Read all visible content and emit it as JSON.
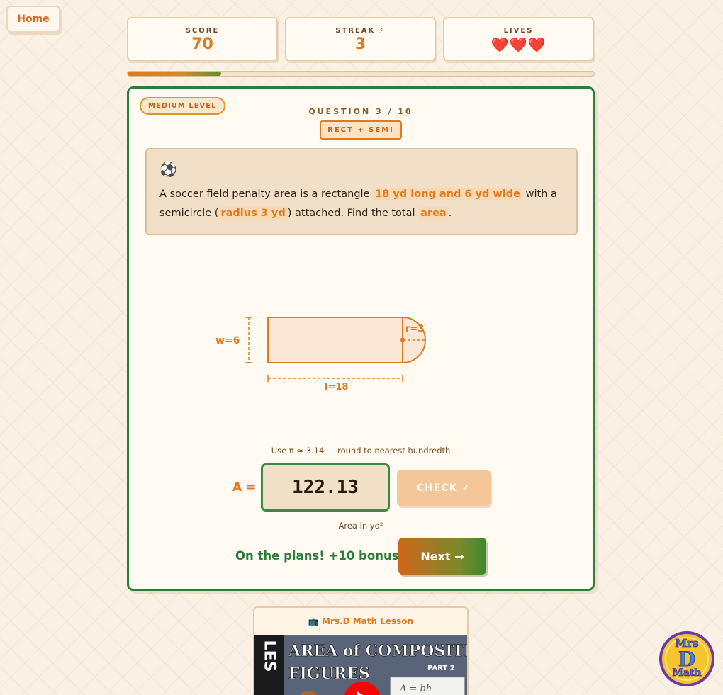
{
  "nav": {
    "home_label": "Home"
  },
  "stats": {
    "score_label": "SCORE",
    "score_value": "70",
    "streak_label": "STREAK ⚡",
    "streak_value": "3",
    "lives_label": "LIVES",
    "lives_value": "❤️❤️❤️"
  },
  "progress": {
    "fraction": 0.2
  },
  "card": {
    "level_badge": "MEDIUM LEVEL",
    "question_counter": "QUESTION 3 / 10",
    "topic_tag": "RECT + SEMI"
  },
  "problem": {
    "icon": "⚽",
    "text_1": "A soccer field penalty area is a rectangle ",
    "highlight_1": "18 yd long and 6 yd wide",
    "text_2": " with a semicircle (",
    "highlight_2": "radius 3 yd",
    "text_3": ") attached. Find the total ",
    "highlight_3": "area",
    "text_4": "."
  },
  "diagram": {
    "width_label": "w=6",
    "radius_label": "r=3",
    "length_label": "l=18",
    "colors": {
      "stroke": "#e07a1e",
      "fill": "#fbe7d6"
    }
  },
  "answer": {
    "hint": "Use π ≈ 3.14 — round to nearest hundredth",
    "prefix_label": "A =",
    "value": "122.13",
    "unit_text": "Area in yd²",
    "check_label": "CHECK ✓"
  },
  "feedback": {
    "message": "On the plans! +10 bonus!",
    "next_label": "Next →"
  },
  "lesson": {
    "title": "📺 Mrs.D Math Lesson",
    "thumb_side_text": "LES",
    "thumb_title_1": "AREA of COMPOSITE",
    "thumb_title_2": "FIGURES",
    "thumb_part": "PART 2",
    "thumb_formula": "A = bh"
  },
  "logo": {
    "line_1": "Mrs",
    "line_2": "D",
    "line_3": "Math"
  },
  "colors": {
    "accent": "#e07a1e",
    "success": "#2d7d3a",
    "background": "#faf1e4"
  }
}
